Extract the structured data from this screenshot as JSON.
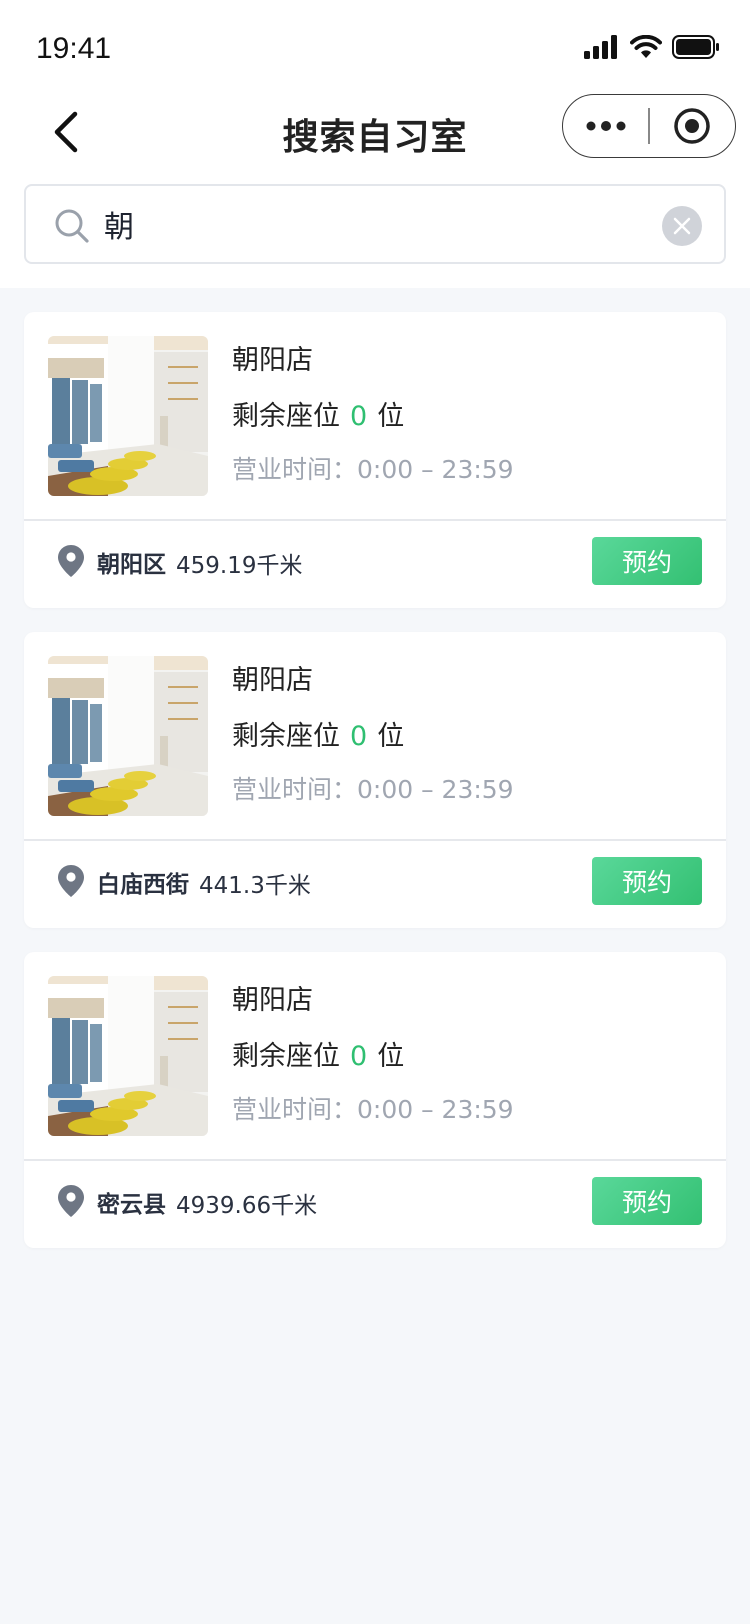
{
  "status_bar": {
    "time": "19:41"
  },
  "nav": {
    "title": "搜索自习室"
  },
  "search": {
    "value": "朝",
    "placeholder": ""
  },
  "results": [
    {
      "store_name": "朝阳店",
      "seats_label": "剩余座位",
      "seats_count": "0",
      "seats_unit": "位",
      "hours": "营业时间：0:00 – 23:59",
      "district": "朝阳区",
      "distance": "459.19千米",
      "book_label": "预约"
    },
    {
      "store_name": "朝阳店",
      "seats_label": "剩余座位",
      "seats_count": "0",
      "seats_unit": "位",
      "hours": "营业时间：0:00 – 23:59",
      "district": "白庙西街",
      "distance": "441.3千米",
      "book_label": "预约"
    },
    {
      "store_name": "朝阳店",
      "seats_label": "剩余座位",
      "seats_count": "0",
      "seats_unit": "位",
      "hours": "营业时间：0:00 – 23:59",
      "district": "密云县",
      "distance": "4939.66千米",
      "book_label": "预约"
    }
  ],
  "colors": {
    "accent": "#2fbf71",
    "button": "#3ec67d",
    "muted_text": "#a0a6b1",
    "background": "#f5f7fa"
  }
}
